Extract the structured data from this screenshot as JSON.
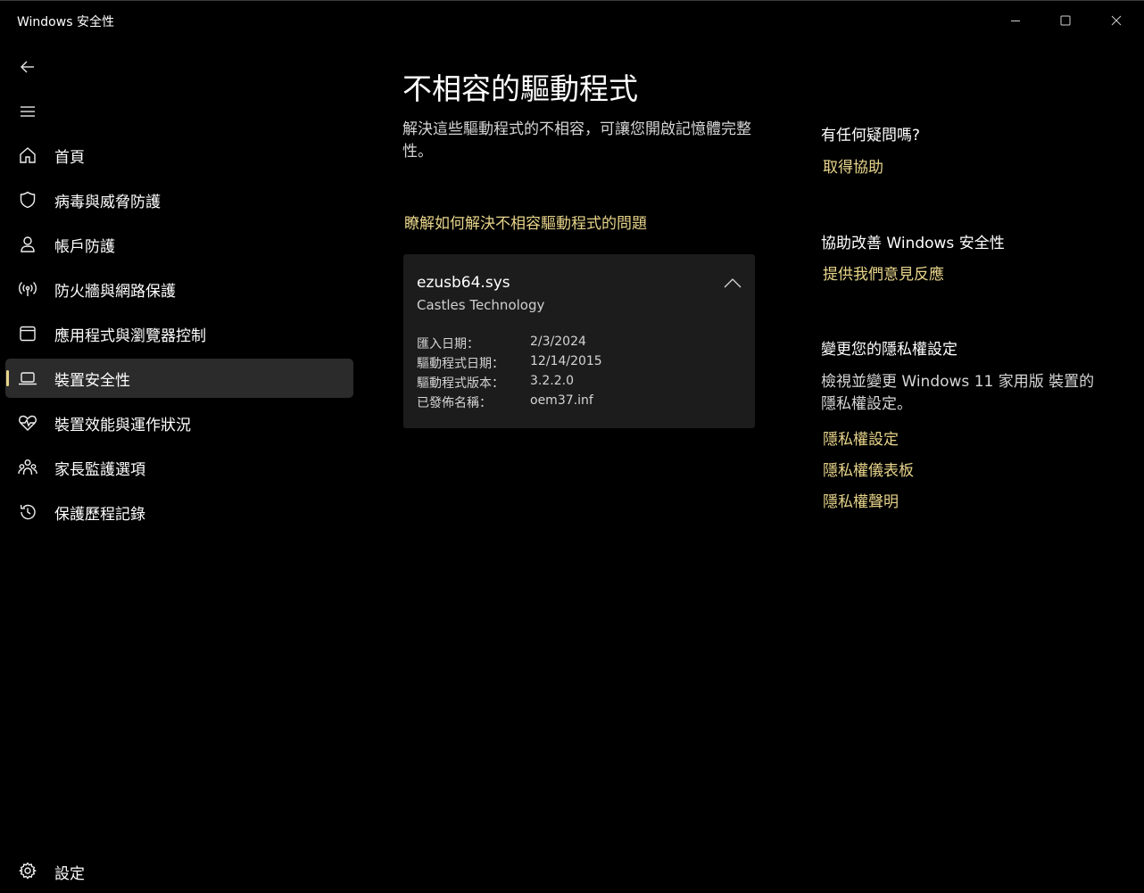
{
  "window": {
    "title": "Windows 安全性"
  },
  "sidebar": {
    "items": [
      {
        "label": "首頁",
        "icon": "home-icon"
      },
      {
        "label": "病毒與威脅防護",
        "icon": "shield-icon"
      },
      {
        "label": "帳戶防護",
        "icon": "person-icon"
      },
      {
        "label": "防火牆與網路保護",
        "icon": "wireless-icon"
      },
      {
        "label": "應用程式與瀏覽器控制",
        "icon": "app-window-icon"
      },
      {
        "label": "裝置安全性",
        "icon": "laptop-icon",
        "selected": true
      },
      {
        "label": "裝置效能與運作狀況",
        "icon": "heart-pulse-icon"
      },
      {
        "label": "家長監護選項",
        "icon": "family-icon"
      },
      {
        "label": "保護歷程記錄",
        "icon": "history-icon"
      }
    ],
    "settings_label": "設定"
  },
  "main": {
    "title": "不相容的驅動程式",
    "description": "解決這些驅動程式的不相容，可讓您開啟記憶體完整性。",
    "learn_link": "瞭解如何解決不相容驅動程式的問題",
    "driver": {
      "name": "ezusb64.sys",
      "vendor": "Castles Technology",
      "details": [
        {
          "key": "匯入日期：",
          "value": "2/3/2024"
        },
        {
          "key": "驅動程式日期：",
          "value": "12/14/2015"
        },
        {
          "key": "驅動程式版本：",
          "value": "3.2.2.0"
        },
        {
          "key": "已發佈名稱：",
          "value": "oem37.inf"
        }
      ]
    }
  },
  "right": {
    "help_heading": "有任何疑問嗎?",
    "help_link": "取得協助",
    "improve_heading": "協助改善 Windows 安全性",
    "feedback_link": "提供我們意見反應",
    "privacy_heading": "變更您的隱私權設定",
    "privacy_text": "檢視並變更 Windows 11 家用版 裝置的隱私權設定。",
    "privacy_links": [
      "隱私權設定",
      "隱私權儀表板",
      "隱私權聲明"
    ]
  },
  "colors": {
    "accent": "#e7d48a",
    "background": "#000000",
    "selected": "#2b2b2b",
    "card": "#1c1c1c"
  }
}
